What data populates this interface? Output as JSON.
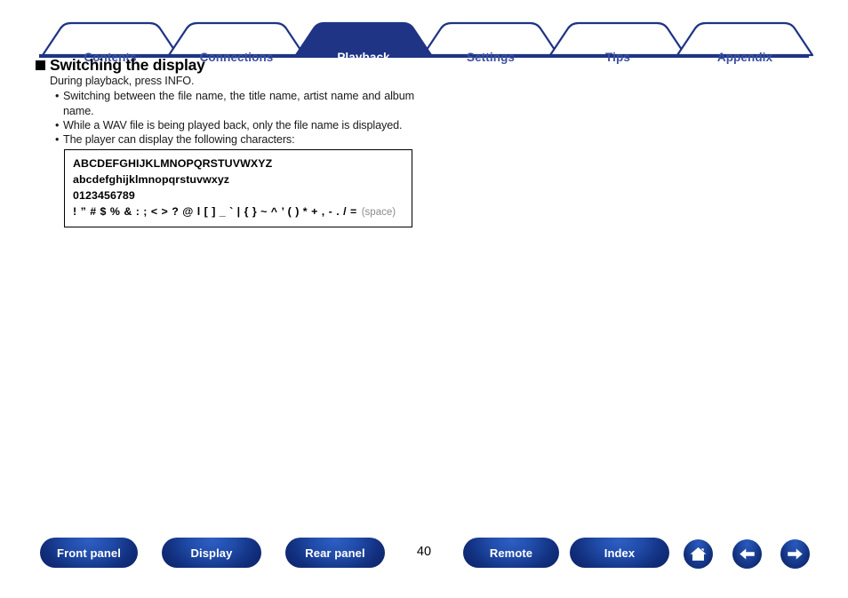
{
  "nav": {
    "tabs": [
      {
        "label": "Contents",
        "active": false
      },
      {
        "label": "Connections",
        "active": false
      },
      {
        "label": "Playback",
        "active": true
      },
      {
        "label": "Settings",
        "active": false
      },
      {
        "label": "Tips",
        "active": false
      },
      {
        "label": "Appendix",
        "active": false
      }
    ],
    "active_tab": "Playback",
    "colors": {
      "tab_border": "#1f3485",
      "tab_inactive_text": "#3b51a0",
      "tab_active_fill": "#1f3485",
      "tab_active_text": "#ffffff",
      "baseline": "#1f3485"
    }
  },
  "main": {
    "heading": "Switching the display",
    "heading_bullet": "filled-square",
    "intro": "During playback, press INFO.",
    "bullets": [
      "Switching between the file name, the title name, artist name and album name.",
      "While a WAV file is being played back, only the file name is displayed.",
      "The player can display the following characters:"
    ],
    "character_box": {
      "uppercase": "ABCDEFGHIJKLMNOPQRSTUVWXYZ",
      "lowercase": "abcdefghijklmnopqrstuvwxyz",
      "digits": "0123456789",
      "symbols": "! ” # $ % & : ; < > ? @ l [ ] _ ` | { } ~ ^ ’ ( ) * + , - . / =",
      "space_note": "(space)"
    }
  },
  "footer": {
    "buttons": [
      {
        "label": "Front panel"
      },
      {
        "label": "Display"
      },
      {
        "label": "Rear panel"
      },
      {
        "label": "Remote"
      },
      {
        "label": "Index"
      }
    ],
    "page_number": "40",
    "icons": [
      {
        "name": "home-icon",
        "glyph": "house"
      },
      {
        "name": "back-icon",
        "glyph": "arrow-left"
      },
      {
        "name": "forward-icon",
        "glyph": "arrow-right"
      }
    ],
    "colors": {
      "pill_gradient_light": "#2f5fc4",
      "pill_gradient_dark": "#0d2368",
      "pill_text": "#ffffff"
    }
  }
}
